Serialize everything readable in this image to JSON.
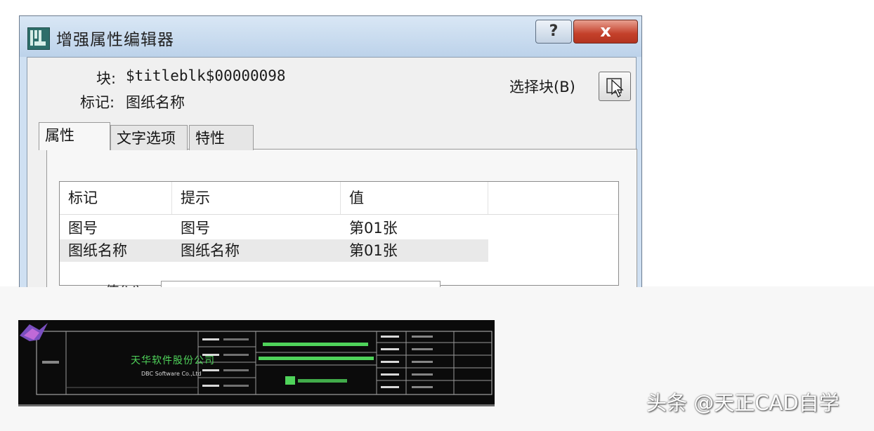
{
  "dialog": {
    "title": "增强属性编辑器",
    "help_label": "?",
    "close_label": "x",
    "block_label": "块:",
    "block_value": "$titleblk$00000098",
    "tag_label": "标记:",
    "tag_value": "图纸名称",
    "select_block_label": "选择块(B)",
    "tabs": [
      "属性",
      "文字选项",
      "特性"
    ],
    "columns": [
      "标记",
      "提示",
      "值"
    ],
    "rows": [
      {
        "tag": "图号",
        "prompt": "图号",
        "value": "第01张"
      },
      {
        "tag": "图纸名称",
        "prompt": "图纸名称",
        "value": "第01张"
      }
    ],
    "value_label": "值(V):"
  },
  "title_block": {
    "company_cn": "天华软件股份公司",
    "company_en": "DBC Software Co.,Ltd"
  },
  "watermark": "头条 @天正CAD自学",
  "colors": {
    "titlebar": "#c8dcf0",
    "close_button": "#c4402a",
    "cad_background": "#0b0b0b",
    "cad_green": "#4fd35a",
    "cad_magenta": "#b04fa8"
  }
}
